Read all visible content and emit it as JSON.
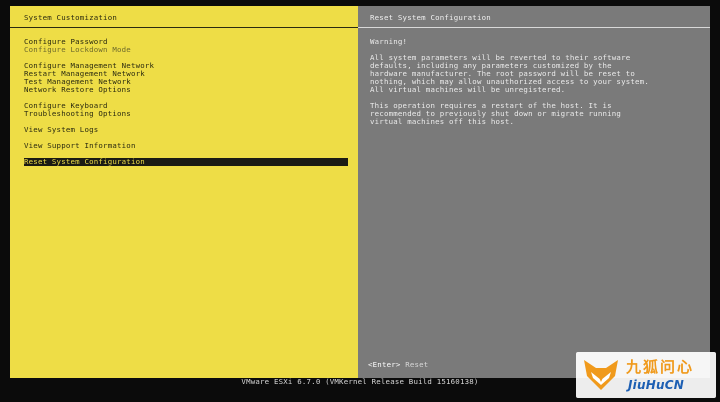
{
  "left_panel": {
    "title": "System Customization",
    "menu": [
      {
        "label": "Configure Password",
        "dim": false
      },
      {
        "label": "Configure Lockdown Mode",
        "dim": true
      },
      {
        "label": "Configure Management Network",
        "dim": false
      },
      {
        "label": "Restart Management Network",
        "dim": false
      },
      {
        "label": "Test Management Network",
        "dim": false
      },
      {
        "label": "Network Restore Options",
        "dim": false
      },
      {
        "label": "Configure Keyboard",
        "dim": false
      },
      {
        "label": "Troubleshooting Options",
        "dim": false
      },
      {
        "label": "View System Logs",
        "dim": false
      },
      {
        "label": "View Support Information",
        "dim": false
      },
      {
        "label": "Reset System Configuration",
        "dim": false,
        "selected": true
      }
    ]
  },
  "right_panel": {
    "title": "Reset System Configuration",
    "warning_heading": "Warning!",
    "paragraph_1": "All system parameters will be reverted to their software\ndefaults, including any parameters customized by the\nhardware manufacturer. The root password will be reset to\nnothing, which may allow unauthorized access to your system.\nAll virtual machines will be unregistered.",
    "paragraph_2": "This operation requires a restart of the host. It is\nrecommended to previously shut down or migrate running\nvirtual machines off this host.",
    "footer_key": "<Enter>",
    "footer_action": "Reset"
  },
  "status_bar": {
    "text": "VMware ESXi 6.7.0 (VMKernel Release Build 15160138)"
  },
  "watermark": {
    "chinese": "九狐问心",
    "latin": "JiuHuCN",
    "icon": "fox-icon",
    "colors": {
      "orange": "#f09a1c",
      "blue": "#1d5fb3"
    }
  },
  "colors": {
    "left_bg": "#eedd46",
    "right_bg": "#7a7a7a",
    "selection_bg": "#1b1b14"
  }
}
